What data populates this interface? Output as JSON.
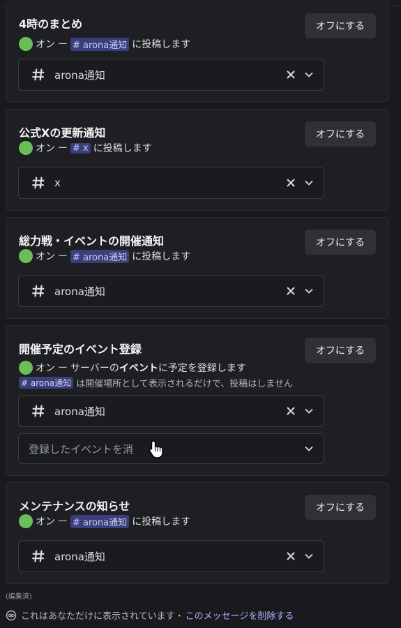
{
  "cards": [
    {
      "title": "4時のまとめ",
      "button": "オフにする",
      "status_on": "オン",
      "status_dash": "ー",
      "channel_mention": "# arona通知",
      "status_suffix": "に投稿します",
      "select_value": "arona通知"
    },
    {
      "title": "公式Xの更新通知",
      "button": "オフにする",
      "status_on": "オン",
      "status_dash": "ー",
      "channel_mention": "# x",
      "status_suffix": "に投稿します",
      "select_value": "x"
    },
    {
      "title": "総力戦・イベントの開催通知",
      "button": "オフにする",
      "status_on": "オン",
      "status_dash": "ー",
      "channel_mention": "# arona通知",
      "status_suffix": "に投稿します",
      "select_value": "arona通知"
    },
    {
      "title": "開催予定のイベント登録",
      "button": "オフにする",
      "status_on": "オン",
      "status_dash": "ー",
      "status_prefix": "サーバーの",
      "status_emph": "イベント",
      "status_suffix": "に予定を登録します",
      "note_mention": "# arona通知",
      "note_text": "は開催場所として表示されるだけで、投稿はしません",
      "select_value": "arona通知",
      "second_select_placeholder": "登録したイベントを消"
    },
    {
      "title": "メンテナンスの知らせ",
      "button": "オフにする",
      "status_on": "オン",
      "status_dash": "ー",
      "channel_mention": "# arona通知",
      "status_suffix": "に投稿します",
      "select_value": "arona通知"
    }
  ],
  "footer": {
    "edited": "(編集済)",
    "ephemeral_text": "これはあなただけに表示されています・",
    "delete_link": "このメッセージを削除する"
  },
  "icons": {
    "channel": "hash-icon",
    "clear": "close-icon",
    "dropdown": "chevron-down-icon",
    "status": "green-dot",
    "visibility": "eye-icon",
    "pointer": "hand-cursor-icon"
  },
  "colors": {
    "background": "#1a1a1e",
    "card": "#1e1f22",
    "button": "#2f3136",
    "status_dot": "#6bbd5a",
    "mention_bg": "#3b3f79",
    "link": "#aab4ff"
  }
}
